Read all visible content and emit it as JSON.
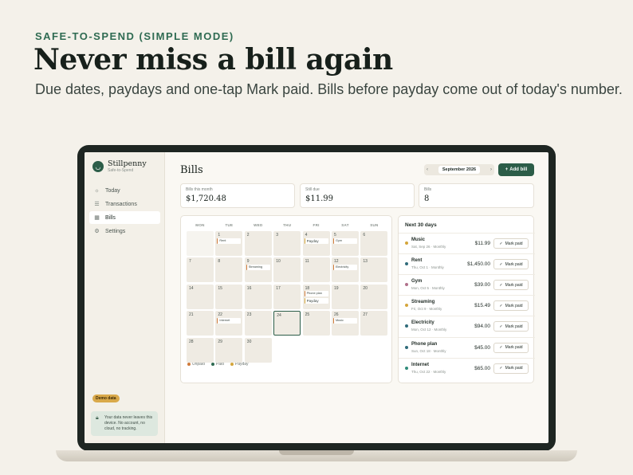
{
  "hero": {
    "eyebrow": "SAFE-TO-SPEND (SIMPLE MODE)",
    "headline": "Never miss a bill again",
    "subhead": "Due dates, paydays and one-tap Mark paid. Bills before payday come out of today's number."
  },
  "app": {
    "brand": {
      "name": "Stillpenny",
      "sub": "Safe-to-Spend"
    },
    "nav": [
      {
        "label": "Today",
        "icon": "sun-icon",
        "active": false
      },
      {
        "label": "Transactions",
        "icon": "list-icon",
        "active": false
      },
      {
        "label": "Bills",
        "icon": "calendar-icon",
        "active": true
      },
      {
        "label": "Settings",
        "icon": "gear-icon",
        "active": false
      }
    ],
    "demo_badge": "Demo data",
    "privacy_note": "Your data never leaves this device. No account, no cloud, no tracking.",
    "page_title": "Bills",
    "month": "September 2026",
    "add_bill_label": "Add bill",
    "stats": [
      {
        "label": "Bills this month",
        "value": "$1,720.48"
      },
      {
        "label": "Still due",
        "value": "$11.99"
      },
      {
        "label": "Bills",
        "value": "8"
      }
    ],
    "calendar": {
      "weekdays": [
        "MON",
        "TUE",
        "WED",
        "THU",
        "FRI",
        "SAT",
        "SUN"
      ],
      "today": 24,
      "days": [
        {
          "n": "",
          "chips": []
        },
        {
          "n": "1",
          "chips": [
            {
              "t": "Rent",
              "k": "bill"
            }
          ]
        },
        {
          "n": "2",
          "chips": []
        },
        {
          "n": "3",
          "chips": []
        },
        {
          "n": "4",
          "chips": [
            {
              "t": "Payday",
              "k": "payday"
            }
          ]
        },
        {
          "n": "5",
          "chips": [
            {
              "t": "Gym",
              "k": "bill"
            }
          ]
        },
        {
          "n": "6",
          "chips": []
        },
        {
          "n": "7",
          "chips": []
        },
        {
          "n": "8",
          "chips": []
        },
        {
          "n": "9",
          "chips": [
            {
              "t": "Streaming",
              "k": "bill"
            }
          ]
        },
        {
          "n": "10",
          "chips": []
        },
        {
          "n": "11",
          "chips": []
        },
        {
          "n": "12",
          "chips": [
            {
              "t": "Electricity",
              "k": "bill"
            }
          ]
        },
        {
          "n": "13",
          "chips": []
        },
        {
          "n": "14",
          "chips": []
        },
        {
          "n": "15",
          "chips": []
        },
        {
          "n": "16",
          "chips": []
        },
        {
          "n": "17",
          "chips": []
        },
        {
          "n": "18",
          "chips": [
            {
              "t": "Phone plan",
              "k": "bill"
            },
            {
              "t": "Payday",
              "k": "payday"
            }
          ]
        },
        {
          "n": "19",
          "chips": []
        },
        {
          "n": "20",
          "chips": []
        },
        {
          "n": "21",
          "chips": []
        },
        {
          "n": "22",
          "chips": [
            {
              "t": "Internet",
              "k": "bill"
            }
          ]
        },
        {
          "n": "23",
          "chips": []
        },
        {
          "n": "24",
          "chips": []
        },
        {
          "n": "25",
          "chips": []
        },
        {
          "n": "26",
          "chips": [
            {
              "t": "Music",
              "k": "bill"
            }
          ]
        },
        {
          "n": "27",
          "chips": []
        },
        {
          "n": "28",
          "chips": []
        },
        {
          "n": "29",
          "chips": []
        },
        {
          "n": "30",
          "chips": []
        }
      ],
      "legend": [
        {
          "label": "Unpaid",
          "color": "#d07a3a"
        },
        {
          "label": "Paid",
          "color": "#2f6b52"
        },
        {
          "label": "Payday",
          "color": "#d4a53a"
        }
      ]
    },
    "upcoming": {
      "title": "Next 30 days",
      "mark_label": "Mark paid",
      "items": [
        {
          "name": "Music",
          "meta": "Sat, Sep 26 · Monthly",
          "amount": "$11.99",
          "color": "#d4a53a"
        },
        {
          "name": "Rent",
          "meta": "Thu, Oct 1 · Monthly",
          "amount": "$1,450.00",
          "color": "#2f6b7a"
        },
        {
          "name": "Gym",
          "meta": "Mon, Oct 5 · Monthly",
          "amount": "$39.00",
          "color": "#b0708a"
        },
        {
          "name": "Streaming",
          "meta": "Fri, Oct 9 · Monthly",
          "amount": "$15.49",
          "color": "#d4a53a"
        },
        {
          "name": "Electricity",
          "meta": "Mon, Oct 12 · Monthly",
          "amount": "$94.00",
          "color": "#2f6b7a"
        },
        {
          "name": "Phone plan",
          "meta": "Sun, Oct 18 · Monthly",
          "amount": "$45.00",
          "color": "#2f6b7a"
        },
        {
          "name": "Internet",
          "meta": "Thu, Oct 22 · Monthly",
          "amount": "$65.00",
          "color": "#2f8b7a"
        }
      ]
    }
  }
}
